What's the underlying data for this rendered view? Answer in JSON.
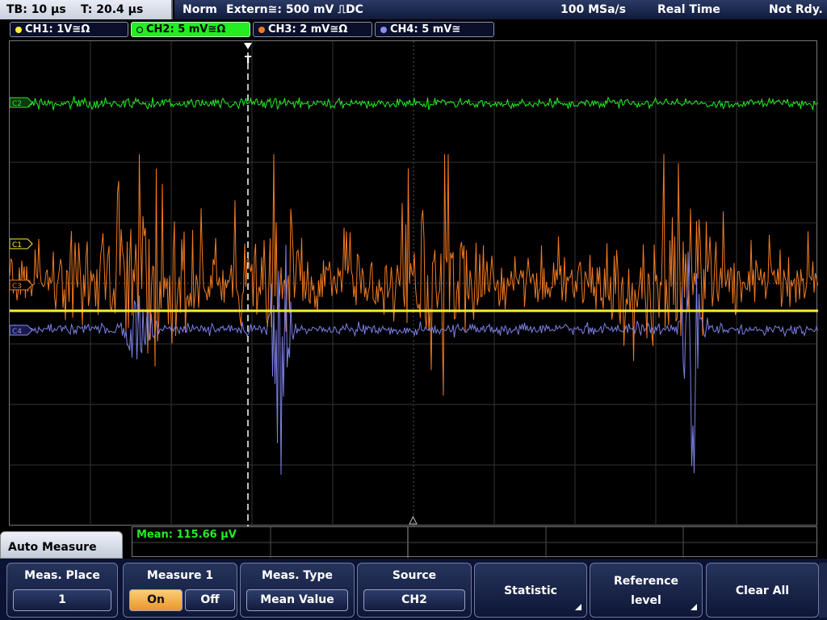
{
  "status": {
    "timebase": "TB: 10 µs",
    "trigger_time": "T: 20.4 µs",
    "mode": "Norm",
    "trigger": "Extern≅: 500 mV ⎍DC",
    "sample_rate": "100 MSa/s",
    "acq_mode": "Real Time",
    "state": "Not Rdy."
  },
  "channels": [
    {
      "label": "CH1: 1V≅Ω",
      "color": "#ffee33"
    },
    {
      "label": "CH2: 5 mV≅Ω",
      "color": "#22ee22"
    },
    {
      "label": "CH3: 2 mV≅Ω",
      "color": "#f07b22"
    },
    {
      "label": "CH4: 5 mV≅",
      "color": "#8a8cf0"
    }
  ],
  "markers": {
    "ch1": "C1",
    "ch2": "C2",
    "ch3": "C3",
    "ch4": "C4",
    "trigger": "T"
  },
  "measurement": {
    "result": "Mean: 115.66 µV"
  },
  "menu": {
    "title": "Auto Measure",
    "softkeys": {
      "meas_place": {
        "label": "Meas. Place",
        "value": "1"
      },
      "measure_1": {
        "label": "Measure 1",
        "on": "On",
        "off": "Off"
      },
      "meas_type": {
        "label": "Meas. Type",
        "value": "Mean Value"
      },
      "source": {
        "label": "Source",
        "value": "CH2"
      },
      "statistic": {
        "label": "Statistic"
      },
      "reference_level": {
        "label1": "Reference",
        "label2": "level"
      },
      "clear_all": {
        "label": "Clear All"
      }
    }
  }
}
